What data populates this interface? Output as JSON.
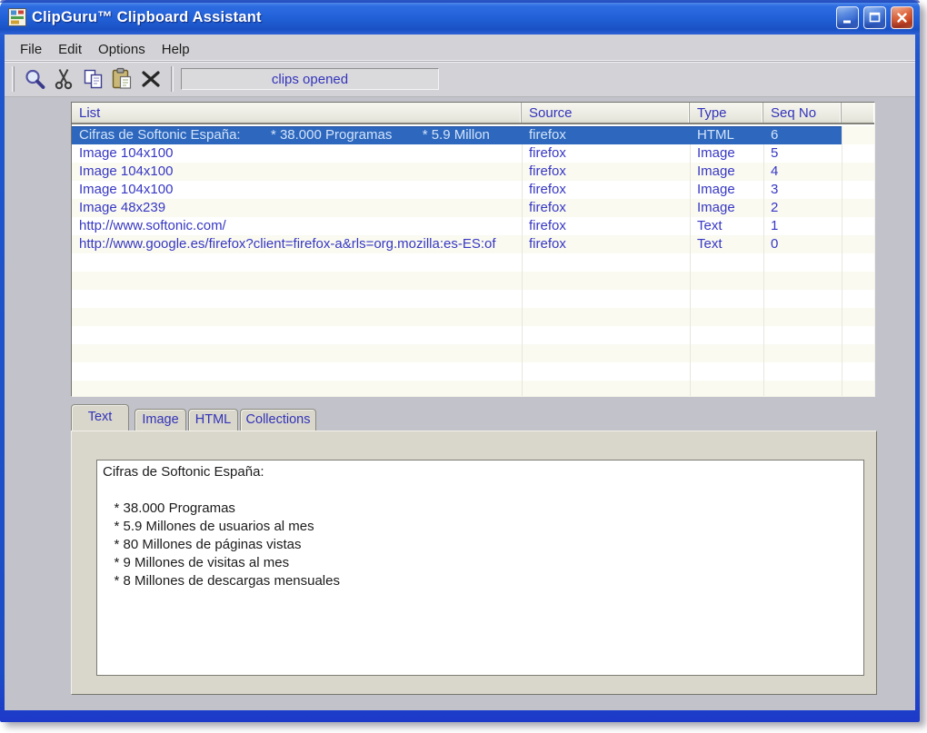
{
  "window": {
    "title": "ClipGuru™ Clipboard Assistant",
    "controls": [
      "minimize",
      "maximize",
      "close"
    ]
  },
  "menu": {
    "items": [
      "File",
      "Edit",
      "Options",
      "Help"
    ]
  },
  "toolbar": {
    "buttons": [
      "search-icon",
      "cut-icon",
      "copy-icon",
      "paste-icon",
      "delete-icon"
    ],
    "status_text": "clips opened"
  },
  "list": {
    "columns": [
      "List",
      "Source",
      "Type",
      "Seq No"
    ],
    "rows": [
      {
        "list": "Cifras de Softonic España:        * 38.000 Programas        * 5.9 Millon",
        "source": "firefox",
        "type": "HTML",
        "seq": "6",
        "selected": true
      },
      {
        "list": "Image 104x100",
        "source": "firefox",
        "type": "Image",
        "seq": "5",
        "selected": false
      },
      {
        "list": "Image 104x100",
        "source": "firefox",
        "type": "Image",
        "seq": "4",
        "selected": false
      },
      {
        "list": "Image 104x100",
        "source": "firefox",
        "type": "Image",
        "seq": "3",
        "selected": false
      },
      {
        "list": "Image 48x239",
        "source": "firefox",
        "type": "Image",
        "seq": "2",
        "selected": false
      },
      {
        "list": "http://www.softonic.com/",
        "source": "firefox",
        "type": "Text",
        "seq": "1",
        "selected": false
      },
      {
        "list": "http://www.google.es/firefox?client=firefox-a&rls=org.mozilla:es-ES:of",
        "source": "firefox",
        "type": "Text",
        "seq": "0",
        "selected": false
      }
    ]
  },
  "tabs": {
    "items": [
      "Text",
      "Image",
      "HTML",
      "Collections"
    ],
    "active": "Text"
  },
  "text_panel": {
    "content": "Cifras de Softonic España:\n\n   * 38.000 Programas\n   * 5.9 Millones de usuarios al mes\n   * 80 Millones de páginas vistas\n   * 9 Millones de visitas al mes\n   * 8 Millones de descargas mensuales"
  },
  "colors": {
    "titlebar_blue": "#2160d6",
    "frame_blue": "#1e53ca",
    "selection_blue": "#2d68be",
    "item_text_blue": "#3737c4",
    "header_text_blue": "#3333bb",
    "close_red": "#cc4018",
    "client_gray": "#c2c2ca",
    "bar_gray": "#d3d3d7",
    "panel_tan": "#d9d6cb"
  }
}
